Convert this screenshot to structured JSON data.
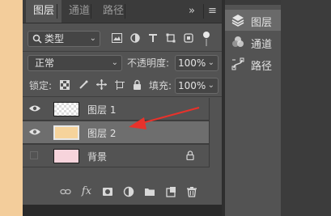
{
  "tabs": [
    {
      "label": "图层",
      "active": true
    },
    {
      "label": "通道",
      "active": false
    },
    {
      "label": "路径",
      "active": false
    }
  ],
  "tab_controls": {
    "expand": "»",
    "menu": "≡"
  },
  "filter": {
    "kind_label": "类型"
  },
  "blend": {
    "mode": "正常",
    "opacity_label": "不透明度:",
    "opacity_value": "100%"
  },
  "lock_row": {
    "label": "锁定:",
    "fill_label": "填充:",
    "fill_value": "100%"
  },
  "layers": [
    {
      "name": "图层 1",
      "visible": true,
      "selected": false,
      "thumb": "transparent"
    },
    {
      "name": "图层 2",
      "visible": true,
      "selected": true,
      "thumb": "solid",
      "color": "#f6d39b"
    },
    {
      "name": "背景",
      "visible": false,
      "selected": false,
      "thumb": "pink",
      "locked": true
    }
  ],
  "toolbar": {
    "fx_label": "fx"
  },
  "right_panel": [
    {
      "label": "图层",
      "icon": "layers-icon",
      "active": true
    },
    {
      "label": "通道",
      "icon": "channels-icon",
      "active": false
    },
    {
      "label": "路径",
      "icon": "paths-icon",
      "active": false
    }
  ],
  "colors": {
    "accent_arrow": "#e8322b",
    "panel_bg": "#535353",
    "selected_row": "#6e6e6e"
  }
}
